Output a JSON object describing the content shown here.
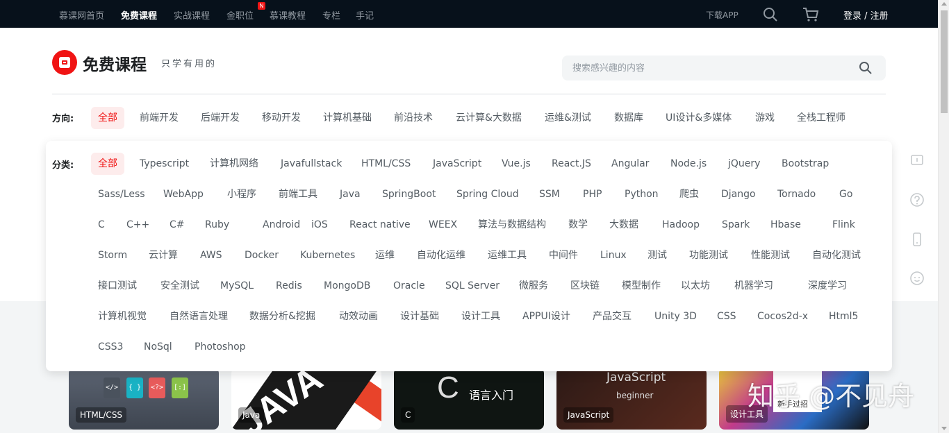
{
  "topnav": {
    "items": [
      {
        "label": "慕课网首页",
        "active": false
      },
      {
        "label": "免费课程",
        "active": true
      },
      {
        "label": "实战课程",
        "active": false
      },
      {
        "label": "金职位",
        "active": false,
        "badge": "N"
      },
      {
        "label": "慕课教程",
        "active": false
      },
      {
        "label": "专栏",
        "active": false
      },
      {
        "label": "手记",
        "active": false
      }
    ],
    "download": "下载APP",
    "login": "登录 / 注册"
  },
  "header": {
    "title": "免费课程",
    "subtitle": "只学有用的",
    "search_placeholder": "搜索感兴趣的内容"
  },
  "direction": {
    "label": "方向:",
    "items": [
      "全部",
      "前端开发",
      "后端开发",
      "移动开发",
      "计算机基础",
      "前沿技术",
      "云计算&大数据",
      "运维&测试",
      "数据库",
      "UI设计&多媒体",
      "游戏",
      "全栈工程师"
    ]
  },
  "category": {
    "label": "分类:",
    "rows": [
      [
        "全部",
        "Typescript",
        "计算机网络",
        "Javafullstack",
        "HTML/CSS",
        "JavaScript",
        "Vue.js",
        "React.JS",
        "Angular",
        "Node.js",
        "jQuery",
        "Bootstrap"
      ],
      [
        "Sass/Less",
        "WebApp",
        "小程序",
        "前端工具",
        "Java",
        "SpringBoot",
        "Spring Cloud",
        "SSM",
        "PHP",
        "Python",
        "爬虫",
        "Django",
        "Tornado",
        "Go"
      ],
      [
        "C",
        "C++",
        "C#",
        "Ruby",
        "Android",
        "iOS",
        "React native",
        "WEEX",
        "算法与数据结构",
        "数学",
        "大数据",
        "Hadoop",
        "Spark",
        "Hbase",
        "Flink"
      ],
      [
        "Storm",
        "云计算",
        "AWS",
        "Docker",
        "Kubernetes",
        "运维",
        "自动化运维",
        "运维工具",
        "中间件",
        "Linux",
        "测试",
        "功能测试",
        "性能测试",
        "自动化测试"
      ],
      [
        "接口测试",
        "安全测试",
        "MySQL",
        "Redis",
        "MongoDB",
        "Oracle",
        "SQL Server",
        "微服务",
        "区块链",
        "模型制作",
        "以太坊",
        "机器学习",
        "深度学习"
      ],
      [
        "计算机视觉",
        "自然语言处理",
        "数据分析&挖掘",
        "动效动画",
        "设计基础",
        "设计工具",
        "APPUI设计",
        "产品交互",
        "Unity 3D",
        "CSS",
        "Cocos2d-x",
        "Html5"
      ],
      [
        "CSS3",
        "NoSql",
        "Photoshop"
      ]
    ]
  },
  "cards": [
    {
      "label": "HTML/CSS"
    },
    {
      "label": "Java",
      "art_text": "JAVA"
    },
    {
      "label": "C",
      "art_letter": "C",
      "art_text": "语言入门"
    },
    {
      "label": "JavaScript",
      "art_text": "JavaScript",
      "art_sub": "beginner"
    },
    {
      "label": "设计工具",
      "art_text": "新手过招"
    }
  ],
  "watermark": "知乎 @不见舟",
  "colors": {
    "accent": "#f01414",
    "nav_bg": "#07111b",
    "active_bg": "#fdecec"
  }
}
